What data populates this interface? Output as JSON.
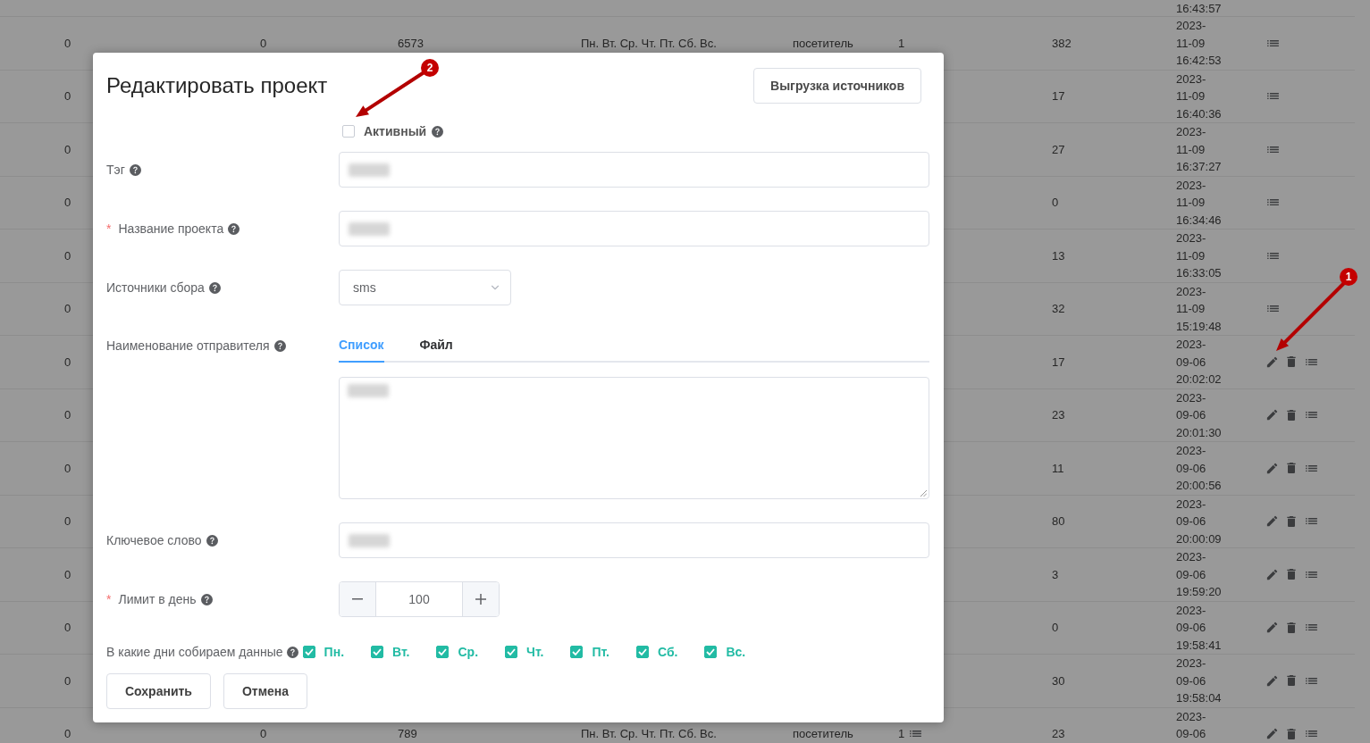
{
  "table": {
    "rows": [
      {
        "kind": "partial",
        "column_8": "16:43:57"
      },
      {
        "kind": "full",
        "column_1": "0",
        "column_2": "0",
        "column_3": "6573",
        "column_4": "Пн. Вт. Ср. Чт. Пт. Сб. Вс.",
        "column_5": "посетитель",
        "column_6": "1",
        "column_6_icon": false,
        "column_7": "382",
        "column_8": "2023-11-09 16:42:53",
        "editable": false
      },
      {
        "kind": "full",
        "column_1": "0",
        "column_7": "17",
        "column_8": "2023-11-09 16:40:36",
        "editable": false
      },
      {
        "kind": "full",
        "column_1": "0",
        "column_7": "27",
        "column_8": "2023-11-09 16:37:27",
        "editable": false
      },
      {
        "kind": "full",
        "column_1": "0",
        "column_7": "0",
        "column_8": "2023-11-09 16:34:46",
        "editable": false
      },
      {
        "kind": "full",
        "column_1": "0",
        "column_7": "13",
        "column_8": "2023-11-09 16:33:05",
        "editable": false
      },
      {
        "kind": "full",
        "column_1": "0",
        "column_7": "32",
        "column_8": "2023-11-09 15:19:48",
        "editable": false
      },
      {
        "kind": "full",
        "column_1": "0",
        "column_7": "17",
        "column_8": "2023-09-06 20:02:02",
        "editable": true,
        "callout": "1"
      },
      {
        "kind": "full",
        "column_1": "0",
        "column_7": "23",
        "column_8": "2023-09-06 20:01:30",
        "editable": true
      },
      {
        "kind": "full",
        "column_1": "0",
        "column_7": "11",
        "column_8": "2023-09-06 20:00:56",
        "editable": true
      },
      {
        "kind": "full",
        "column_1": "0",
        "column_7": "80",
        "column_8": "2023-09-06 20:00:09",
        "editable": true
      },
      {
        "kind": "full",
        "column_1": "0",
        "column_7": "3",
        "column_8": "2023-09-06 19:59:20",
        "editable": true
      },
      {
        "kind": "full",
        "column_1": "0",
        "column_7": "0",
        "column_8": "2023-09-06 19:58:41",
        "editable": true
      },
      {
        "kind": "full",
        "column_1": "0",
        "column_7": "30",
        "column_8": "2023-09-06 19:58:04",
        "editable": true
      },
      {
        "kind": "full",
        "column_1": "0",
        "column_2": "0",
        "column_3": "789",
        "column_4": "Пн. Вт. Ср. Чт. Пт. Сб. Вс.",
        "column_5": "посетитель",
        "column_6": "1",
        "column_6_icon": true,
        "column_7": "23",
        "column_8": "2023-09-06",
        "editable": true
      }
    ]
  },
  "dialog": {
    "title": "Редактировать проект",
    "export_button": "Выгрузка источников",
    "active_checkbox": {
      "label": "Активный",
      "checked": false,
      "help": true,
      "callout": "2"
    },
    "fields": [
      {
        "kind": "text",
        "label": "Тэг",
        "help": true,
        "value_blurred": true
      },
      {
        "kind": "text",
        "label": "Название проекта",
        "required_mark": "*",
        "help": true,
        "value_blurred": true
      },
      {
        "kind": "select",
        "label": "Источники сбора",
        "help": true,
        "value": "sms"
      },
      {
        "kind": "tabs",
        "label": "Наименование отправителя",
        "help": true,
        "tabs": [
          {
            "label": "Список",
            "selected": true
          },
          {
            "label": "Файл",
            "selected": false
          }
        ],
        "value_blurred": true
      },
      {
        "kind": "text",
        "label": "Ключевое слово",
        "help": true,
        "value_blurred": true
      },
      {
        "kind": "number",
        "label": "Лимит в день",
        "required_mark": "*",
        "help": true,
        "value": "100"
      }
    ],
    "days": {
      "label": "В какие дни собираем данные",
      "help": true,
      "items": [
        {
          "label": "Пн.",
          "checked": true
        },
        {
          "label": "Вт.",
          "checked": true
        },
        {
          "label": "Ср.",
          "checked": true
        },
        {
          "label": "Чт.",
          "checked": true
        },
        {
          "label": "Пт.",
          "checked": true
        },
        {
          "label": "Сб.",
          "checked": true
        },
        {
          "label": "Вс.",
          "checked": true
        }
      ]
    },
    "buttons": [
      {
        "label": "Сохранить"
      },
      {
        "label": "Отмена"
      }
    ]
  }
}
